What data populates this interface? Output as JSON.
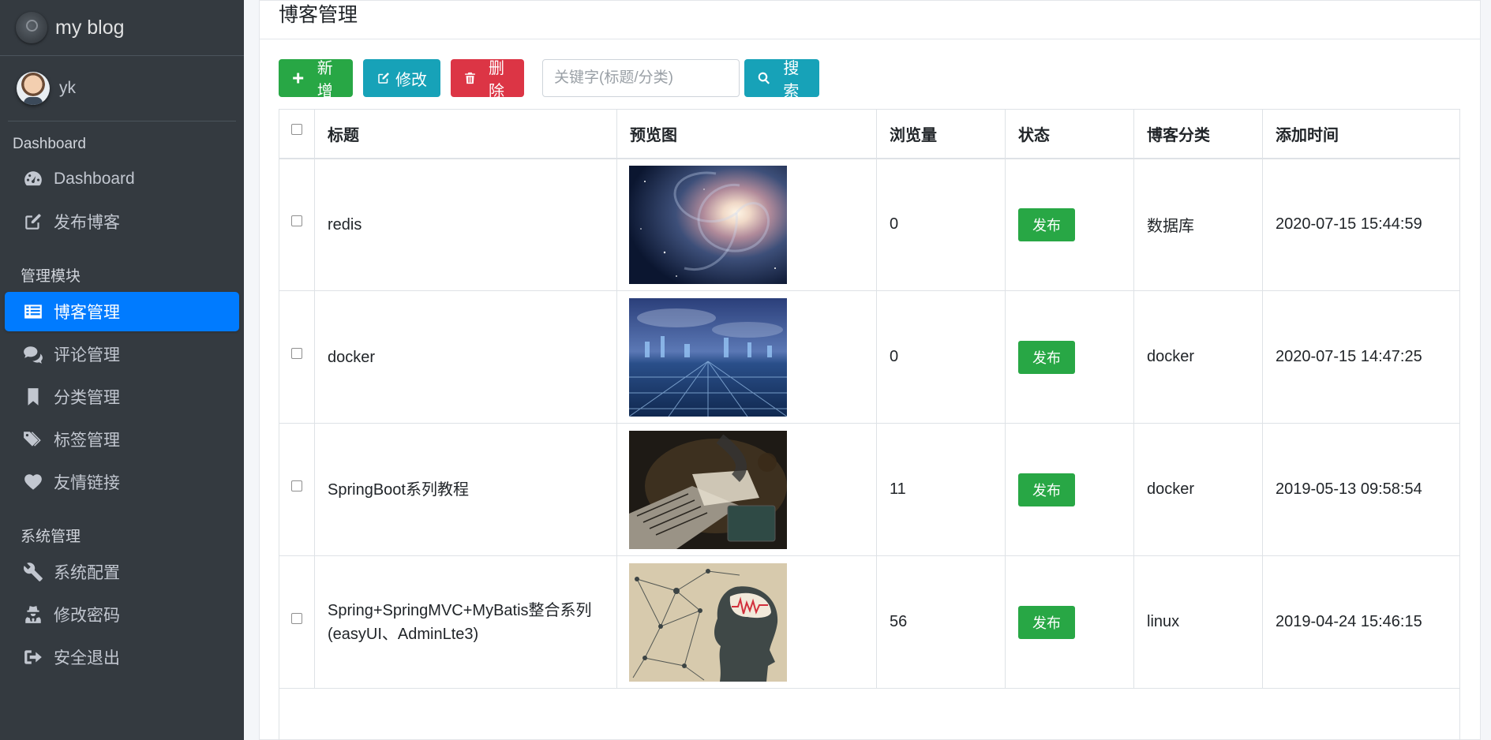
{
  "sidebar": {
    "brand": "my blog",
    "user": "yk",
    "sections": [
      {
        "header": "Dashboard",
        "items": [
          {
            "label": "Dashboard",
            "icon": "tachometer-icon"
          },
          {
            "label": "发布博客",
            "icon": "edit-icon"
          }
        ]
      },
      {
        "header": "管理模块",
        "items": [
          {
            "label": "博客管理",
            "icon": "list-icon"
          },
          {
            "label": "评论管理",
            "icon": "comments-icon"
          },
          {
            "label": "分类管理",
            "icon": "bookmark-icon"
          },
          {
            "label": "标签管理",
            "icon": "tags-icon"
          },
          {
            "label": "友情链接",
            "icon": "heart-icon"
          }
        ]
      },
      {
        "header": "系统管理",
        "items": [
          {
            "label": "系统配置",
            "icon": "wrench-icon"
          },
          {
            "label": "修改密码",
            "icon": "user-secret-icon"
          },
          {
            "label": "安全退出",
            "icon": "sign-out-icon"
          }
        ]
      }
    ],
    "active_item": "博客管理"
  },
  "page": {
    "title": "博客管理"
  },
  "toolbar": {
    "add": "新增",
    "edit": "修改",
    "delete": "删除",
    "search_placeholder": "关键字(标题/分类)",
    "search": "搜索"
  },
  "table": {
    "columns": [
      "标题",
      "预览图",
      "浏览量",
      "状态",
      "博客分类",
      "添加时间"
    ],
    "rows": [
      {
        "title": "redis",
        "image": "galaxy-image",
        "views": "0",
        "status": "发布",
        "category": "数据库",
        "time": "2020-07-15 15:44:59"
      },
      {
        "title": "docker",
        "image": "city-image",
        "views": "0",
        "status": "发布",
        "category": "docker",
        "time": "2020-07-15 14:47:25"
      },
      {
        "title": "SpringBoot系列教程",
        "image": "laptop-image",
        "views": "11",
        "status": "发布",
        "category": "docker",
        "time": "2019-05-13 09:58:54"
      },
      {
        "title": "Spring+SpringMVC+MyBatis整合系列(easyUI、AdminLte3)",
        "image": "brain-network-image",
        "views": "56",
        "status": "发布",
        "category": "linux",
        "time": "2019-04-24 15:46:15"
      }
    ]
  },
  "colors": {
    "sidebar_bg": "#343a40",
    "active": "#007bff",
    "success": "#28a745",
    "info": "#17a2b8",
    "danger": "#dc3545"
  }
}
